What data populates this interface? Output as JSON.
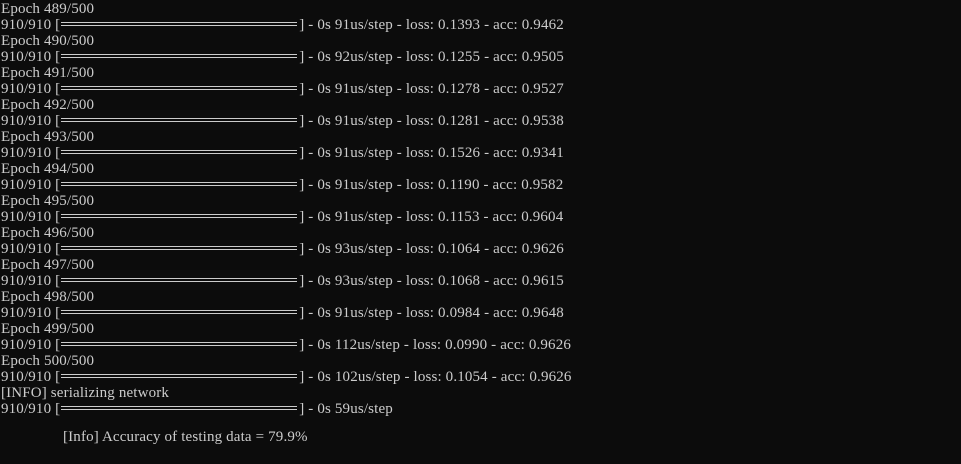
{
  "colors": {
    "background": "#0c0c0c",
    "text": "#cccccc"
  },
  "log": [
    {
      "kind": "epoch",
      "text": "Epoch 489/500"
    },
    {
      "kind": "progress",
      "prefix": "910/910 [",
      "suffix": "] - 0s 91us/step - loss: 0.1393 - acc: 0.9462"
    },
    {
      "kind": "epoch",
      "text": "Epoch 490/500"
    },
    {
      "kind": "progress",
      "prefix": "910/910 [",
      "suffix": "] - 0s 92us/step - loss: 0.1255 - acc: 0.9505"
    },
    {
      "kind": "epoch",
      "text": "Epoch 491/500"
    },
    {
      "kind": "progress",
      "prefix": "910/910 [",
      "suffix": "] - 0s 91us/step - loss: 0.1278 - acc: 0.9527"
    },
    {
      "kind": "epoch",
      "text": "Epoch 492/500"
    },
    {
      "kind": "progress",
      "prefix": "910/910 [",
      "suffix": "] - 0s 91us/step - loss: 0.1281 - acc: 0.9538"
    },
    {
      "kind": "epoch",
      "text": "Epoch 493/500"
    },
    {
      "kind": "progress",
      "prefix": "910/910 [",
      "suffix": "] - 0s 91us/step - loss: 0.1526 - acc: 0.9341"
    },
    {
      "kind": "epoch",
      "text": "Epoch 494/500"
    },
    {
      "kind": "progress",
      "prefix": "910/910 [",
      "suffix": "] - 0s 91us/step - loss: 0.1190 - acc: 0.9582"
    },
    {
      "kind": "epoch",
      "text": "Epoch 495/500"
    },
    {
      "kind": "progress",
      "prefix": "910/910 [",
      "suffix": "] - 0s 91us/step - loss: 0.1153 - acc: 0.9604"
    },
    {
      "kind": "epoch",
      "text": "Epoch 496/500"
    },
    {
      "kind": "progress",
      "prefix": "910/910 [",
      "suffix": "] - 0s 93us/step - loss: 0.1064 - acc: 0.9626"
    },
    {
      "kind": "epoch",
      "text": "Epoch 497/500"
    },
    {
      "kind": "progress",
      "prefix": "910/910 [",
      "suffix": "] - 0s 93us/step - loss: 0.1068 - acc: 0.9615"
    },
    {
      "kind": "epoch",
      "text": "Epoch 498/500"
    },
    {
      "kind": "progress",
      "prefix": "910/910 [",
      "suffix": "] - 0s 91us/step - loss: 0.0984 - acc: 0.9648"
    },
    {
      "kind": "epoch",
      "text": "Epoch 499/500"
    },
    {
      "kind": "progress",
      "prefix": "910/910 [",
      "suffix": "] - 0s 112us/step - loss: 0.0990 - acc: 0.9626"
    },
    {
      "kind": "epoch",
      "text": "Epoch 500/500"
    },
    {
      "kind": "progress",
      "prefix": "910/910 [",
      "suffix": "] - 0s 102us/step - loss: 0.1054 - acc: 0.9626"
    },
    {
      "kind": "info",
      "text": "[INFO] serializing network"
    },
    {
      "kind": "progress",
      "prefix": "910/910 [",
      "suffix": "] - 0s 59us/step"
    },
    {
      "kind": "blank",
      "text": ""
    },
    {
      "kind": "result",
      "text": "[Info] Accuracy of testing data = 79.9%"
    }
  ]
}
